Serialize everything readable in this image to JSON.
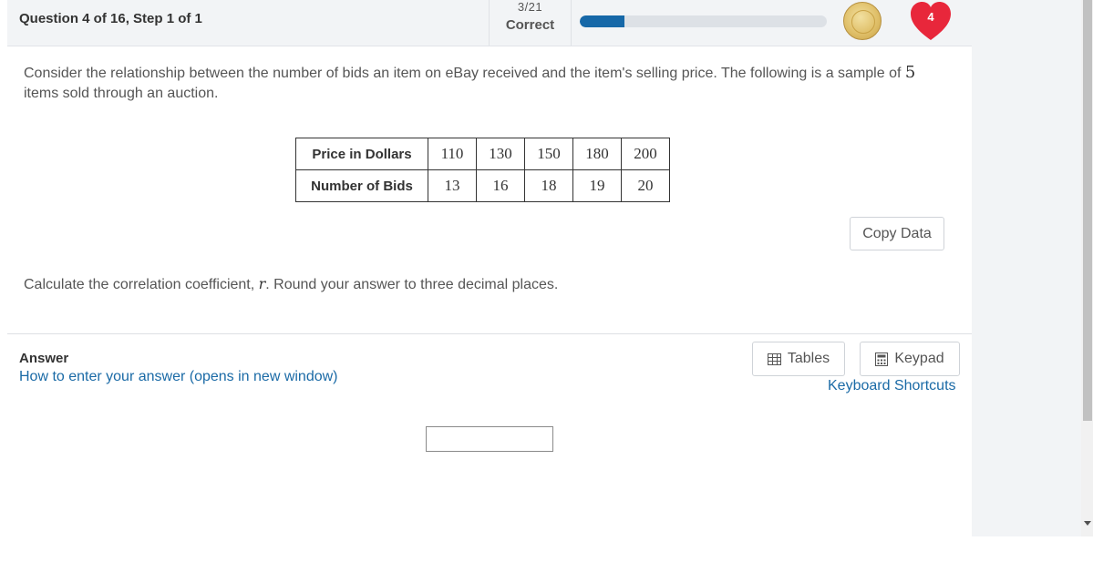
{
  "header": {
    "question_title": "Question 4 of 16, Step 1 of 1",
    "score_fraction": "3/21",
    "score_status": "Correct",
    "progress_fraction": 0.18,
    "progress_color": "#1668a8",
    "lives_count": "4",
    "heart_color": "#e8273b",
    "coin_icon": "medal-coin-icon"
  },
  "question": {
    "prompt_text": "Consider the relationship between the number of bids an item on eBay received and the item's selling price. The following is a sample of ",
    "prompt_number": "5",
    "prompt_end": "items sold through an auction.",
    "table": {
      "rows": [
        {
          "label": "Price in Dollars",
          "values": [
            "110",
            "130",
            "150",
            "180",
            "200"
          ]
        },
        {
          "label": "Number of Bids",
          "values": [
            "13",
            "16",
            "18",
            "19",
            "20"
          ]
        }
      ]
    },
    "copy_button": "Copy Data",
    "instruction_pre": "Calculate the correlation coefficient, ",
    "instruction_var": "r",
    "instruction_post": ". Round your answer to three decimal places."
  },
  "answer": {
    "label": "Answer",
    "help_link": "How to enter your answer (opens in new window)",
    "tables_button": "Tables",
    "keypad_button": "Keypad",
    "keyboard_link": "Keyboard Shortcuts",
    "input_value": ""
  }
}
